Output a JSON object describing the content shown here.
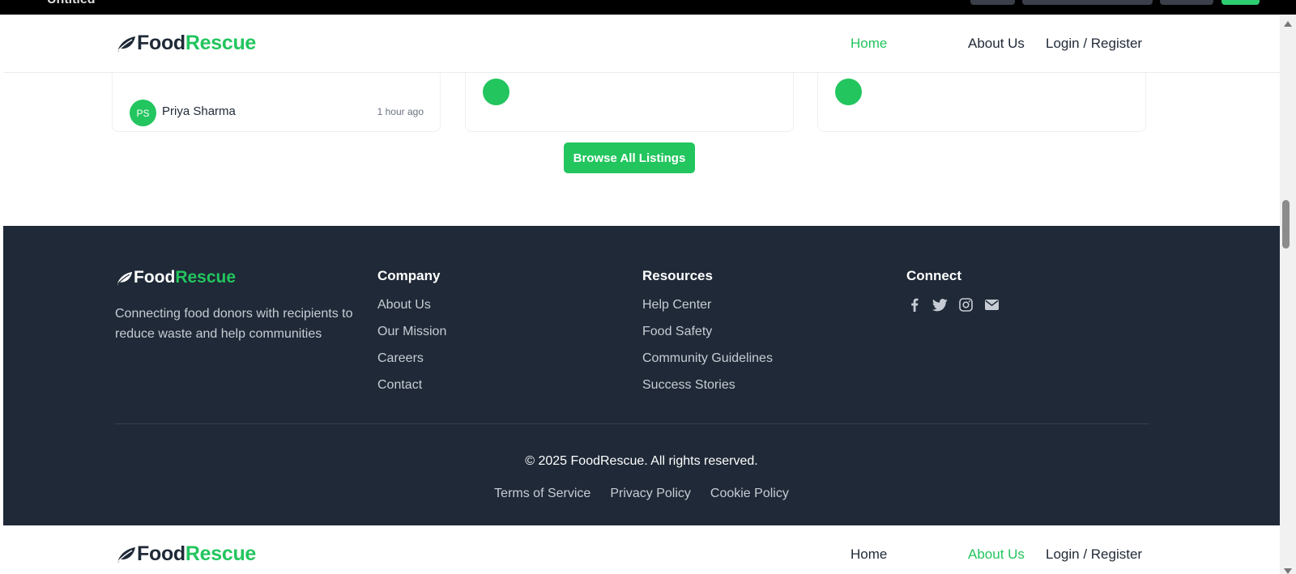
{
  "window": {
    "title": "Untitled"
  },
  "brand": {
    "name_part1": "Food",
    "name_part2": "Rescue"
  },
  "nav": {
    "home": "Home",
    "about": "About Us",
    "login": "Login / Register"
  },
  "listing": {
    "avatar_initials": "PS",
    "donor_name": "Priya Sharma",
    "time_ago": "1 hour ago"
  },
  "browse_button": "Browse All Listings",
  "footer": {
    "description": "Connecting food donors with recipients to reduce waste and help communities",
    "company": {
      "heading": "Company",
      "links": [
        "About Us",
        "Our Mission",
        "Careers",
        "Contact"
      ]
    },
    "resources": {
      "heading": "Resources",
      "links": [
        "Help Center",
        "Food Safety",
        "Community Guidelines",
        "Success Stories"
      ]
    },
    "connect": {
      "heading": "Connect",
      "icons": [
        "facebook-icon",
        "twitter-icon",
        "instagram-icon",
        "envelope-icon"
      ]
    },
    "copyright": "© 2025 FoodRescue. All rights reserved.",
    "legal": [
      "Terms of Service",
      "Privacy Policy",
      "Cookie Policy"
    ]
  },
  "colors": {
    "accent": "#22c55e",
    "footer_bg": "#1f2937",
    "text_dark": "#1f2937",
    "text_muted": "#c7ccd4"
  }
}
